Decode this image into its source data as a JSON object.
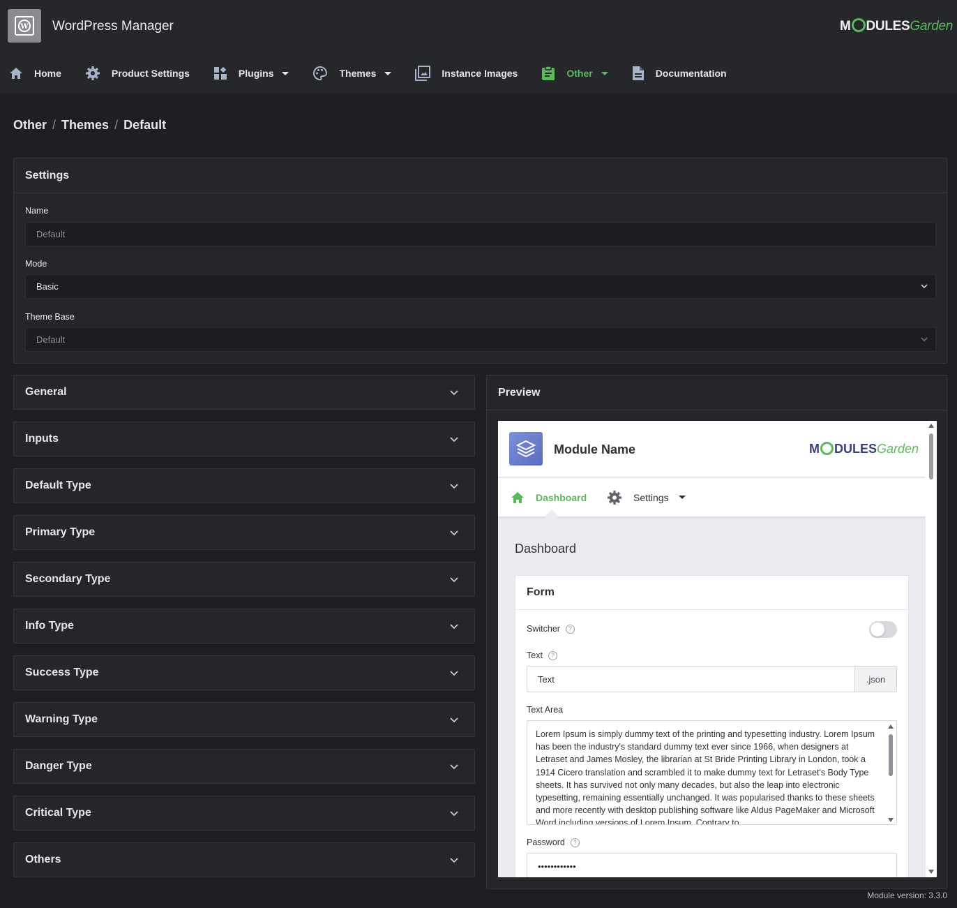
{
  "app": {
    "title": "WordPress Manager",
    "brand_main": "M",
    "brand_mid": "DULES",
    "brand_garden": "Garden"
  },
  "nav": {
    "home": "Home",
    "product_settings": "Product Settings",
    "plugins": "Plugins",
    "themes": "Themes",
    "instance_images": "Instance Images",
    "other": "Other",
    "documentation": "Documentation"
  },
  "breadcrumb": [
    "Other",
    "Themes",
    "Default"
  ],
  "settings": {
    "title": "Settings",
    "name_label": "Name",
    "name_value": "Default",
    "mode_label": "Mode",
    "mode_value": "Basic",
    "theme_base_label": "Theme Base",
    "theme_base_value": "Default"
  },
  "sections": [
    "General",
    "Inputs",
    "Default Type",
    "Primary Type",
    "Secondary Type",
    "Info Type",
    "Success Type",
    "Warning Type",
    "Danger Type",
    "Critical Type",
    "Others"
  ],
  "preview": {
    "title": "Preview",
    "module_name": "Module Name",
    "nav_dashboard": "Dashboard",
    "nav_settings": "Settings",
    "page_title": "Dashboard",
    "form_title": "Form",
    "switcher_label": "Switcher",
    "text_label": "Text",
    "text_value": "Text",
    "text_addon": ".json",
    "textarea_label": "Text Area",
    "textarea_value": "Lorem Ipsum is simply dummy text of the printing and typesetting industry. Lorem Ipsum has been the industry's standard dummy text ever since 1966, when designers at Letraset and James Mosley, the librarian at St Bride Printing Library in London, took a 1914 Cicero translation and scrambled it to make dummy text for Letraset's Body Type sheets. It has survived not only many decades, but also the leap into electronic typesetting, remaining essentially unchanged. It was popularised thanks to these sheets and more recently with desktop publishing software like Aldus PageMaker and Microsoft Word including versions of Lorem Ipsum. Contrary to",
    "password_label": "Password",
    "password_value": "••••••••••••"
  },
  "footer": {
    "version": "Module version: 3.3.0"
  },
  "colors": {
    "accent": "#5cb85c",
    "background": "#1d1f23",
    "panel": "#24262a"
  }
}
